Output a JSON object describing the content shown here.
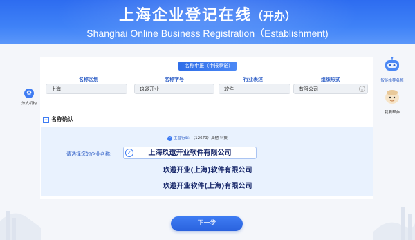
{
  "header": {
    "title_cn": "上海企业登记在线",
    "title_cn_suffix": "（开办）",
    "title_en": "Shanghai Online Business Registration（Establishment)"
  },
  "name_declaration": {
    "section_tab": "名称申报（申报承诺)",
    "fields": [
      {
        "label": "名称区划",
        "value": "上海"
      },
      {
        "label": "名称字号",
        "value": "玖遨开业"
      },
      {
        "label": "行业表述",
        "value": "软件"
      },
      {
        "label": "组织形式",
        "value": "有限公司"
      }
    ]
  },
  "side_left": {
    "label": "分支机构",
    "icon": "branch-icon"
  },
  "side_right": [
    {
      "label": "智能推荐名称",
      "icon": "robot-icon"
    },
    {
      "label": "我要帮办",
      "icon": "assistant-icon"
    }
  ],
  "confirm": {
    "title": "名称确认",
    "industry_label": "主营行业:",
    "industry_value": "（12679）其他  科技",
    "choose_label": "请选择您的企业名称:",
    "options": [
      "上海玖遨开业软件有限公司",
      "玖遨开业(上海)软件有限公司",
      "玖遨开业软件(上海)有限公司"
    ],
    "selected_index": 0
  },
  "actions": {
    "next_label": "下一步"
  },
  "colors": {
    "primary": "#3e7cf3",
    "header_blue": "#2d6cf0",
    "confirm_bg": "#e9f2fe",
    "label_blue": "#2f5fc6"
  }
}
